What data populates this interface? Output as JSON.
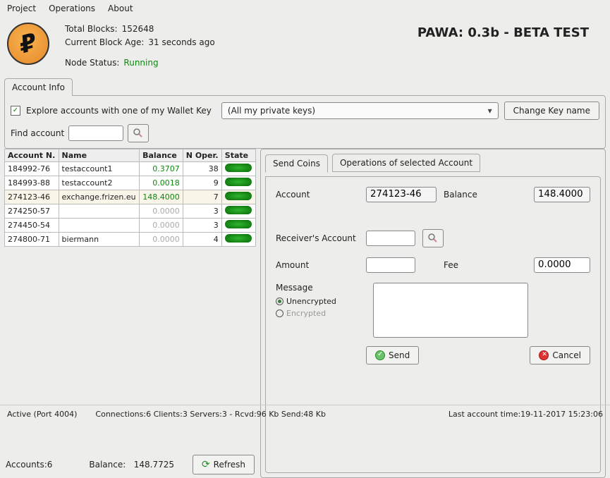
{
  "menu": {
    "project": "Project",
    "operations": "Operations",
    "about": "About"
  },
  "header": {
    "title": "PAWA: 0.3b - BETA TEST",
    "total_blocks_label": "Total Blocks:",
    "total_blocks": "152648",
    "block_age_label": "Current Block Age:",
    "block_age": "31 seconds ago",
    "node_status_label": "Node Status:",
    "node_status": "Running"
  },
  "tabs": {
    "account_info": "Account Info"
  },
  "explore": {
    "label": "Explore accounts with one of my Wallet Key",
    "select": "(All my private keys)",
    "change_key": "Change Key name",
    "find_label": "Find account",
    "find_value": ""
  },
  "table": {
    "headers": {
      "acct": "Account N.",
      "name": "Name",
      "balance": "Balance",
      "noper": "N Oper.",
      "state": "State"
    },
    "rows": [
      {
        "acct": "184992-76",
        "name": "testaccount1",
        "balance": "0.3707",
        "noper": "38",
        "sel": false,
        "zero": false
      },
      {
        "acct": "184993-88",
        "name": "testaccount2",
        "balance": "0.0018",
        "noper": "9",
        "sel": false,
        "zero": false
      },
      {
        "acct": "274123-46",
        "name": "exchange.frizen.eu",
        "balance": "148.4000",
        "noper": "7",
        "sel": true,
        "zero": false
      },
      {
        "acct": "274250-57",
        "name": "",
        "balance": "0.0000",
        "noper": "3",
        "sel": false,
        "zero": true
      },
      {
        "acct": "274450-54",
        "name": "",
        "balance": "0.0000",
        "noper": "3",
        "sel": false,
        "zero": true
      },
      {
        "acct": "274800-71",
        "name": "biermann",
        "balance": "0.0000",
        "noper": "4",
        "sel": false,
        "zero": true
      }
    ],
    "footer": {
      "accounts_label": "Accounts:",
      "accounts": "6",
      "balance_label": "Balance:",
      "balance": "148.7725",
      "refresh": "Refresh"
    }
  },
  "send": {
    "tab_send": "Send Coins",
    "tab_ops": "Operations of selected Account",
    "account_label": "Account",
    "account": "274123-46",
    "balance_label": "Balance",
    "balance": "148.4000",
    "receiver_label": "Receiver's Account",
    "receiver": "",
    "amount_label": "Amount",
    "amount": "",
    "fee_label": "Fee",
    "fee": "0.0000",
    "message_label": "Message",
    "unencrypted": "Unencrypted",
    "encrypted": "Encrypted",
    "message": "",
    "send_btn": "Send",
    "cancel_btn": "Cancel"
  },
  "status": {
    "active": "Active (Port 4004)",
    "conn": "Connections:6 Clients:3 Servers:3 - Rcvd:96 Kb Send:48 Kb",
    "last": "Last account time:19-11-2017 15:23:06"
  }
}
